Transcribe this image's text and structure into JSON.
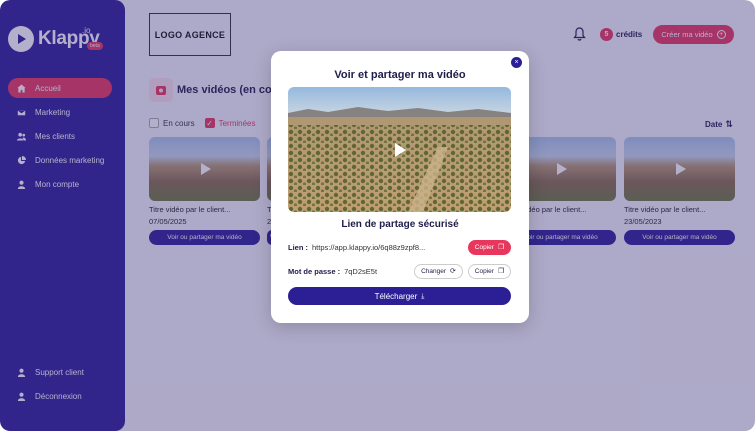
{
  "brand": {
    "name": "Klappy",
    "suffix": ".io",
    "badge": "beta"
  },
  "sidebar": {
    "items": [
      {
        "label": "Accueil",
        "icon": "home-icon",
        "active": true
      },
      {
        "label": "Marketing",
        "icon": "mail-icon",
        "active": false
      },
      {
        "label": "Mes clients",
        "icon": "users-icon",
        "active": false
      },
      {
        "label": "Données marketing",
        "icon": "pie-chart-icon",
        "active": false
      },
      {
        "label": "Mon compte",
        "icon": "user-icon",
        "active": false
      }
    ],
    "bottom_items": [
      {
        "label": "Support client",
        "icon": "user-icon"
      },
      {
        "label": "Déconnexion",
        "icon": "user-icon"
      }
    ]
  },
  "header": {
    "agency_logo": "LOGO AGENCE",
    "credits_count": "5",
    "credits_label": "crédits",
    "create_button": "Créer ma vidéo"
  },
  "main": {
    "section_title": "Mes vidéos (en cours",
    "filters": [
      {
        "label": "En cours",
        "checked": false
      },
      {
        "label": "Terminées",
        "checked": true
      }
    ],
    "sort_label": "Date",
    "cards": [
      {
        "title": "Titre vidéo par le client...",
        "date": "07/05/2025",
        "button": "Voir ou partager ma vidéo"
      },
      {
        "title": "Tit",
        "date": "2",
        "button": "V"
      },
      {
        "title": "Titre vidéo par le client...",
        "date": "2023",
        "button": "Voir ou partager ma vidéo"
      },
      {
        "title": "Titre vidéo par le client...",
        "date": "23/05/2023",
        "button": "Voir ou partager ma vidéo"
      }
    ]
  },
  "modal": {
    "title": "Voir et partager ma vidéo",
    "subtitle": "Lien de partage sécurisé",
    "link_label": "Lien :",
    "link_value": "https://app.klappy.io/6q88z9zpf8...",
    "copy_label": "Copier",
    "password_label": "Mot de passe :",
    "password_value": "7qD2sE5t",
    "change_label": "Changer",
    "download_label": "Télécharger",
    "close_symbol": "×"
  },
  "colors": {
    "primary": "#2c1f96",
    "accent": "#e8375d"
  }
}
